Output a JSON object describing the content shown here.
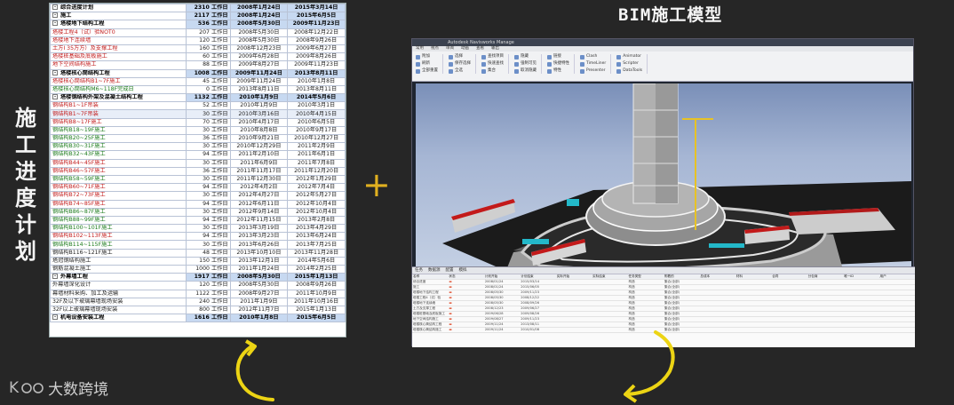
{
  "vertical_label": [
    "施",
    "工",
    "进",
    "度",
    "计",
    "划"
  ],
  "bim_title": "BIM施工模型",
  "plus_sign": "+",
  "schedule": {
    "rows": [
      {
        "level": 0,
        "toggle": "-",
        "name": "综合进度计划",
        "duration": "2310 工作日",
        "start": "2008年1月24日",
        "end": "2015年3月14日",
        "summary": true
      },
      {
        "level": 1,
        "toggle": "-",
        "name": "施工",
        "duration": "2117 工作日",
        "start": "2008年1月24日",
        "end": "2015年6月5日",
        "summary": true
      },
      {
        "level": 2,
        "toggle": "-",
        "name": "塔楼地下结构工程",
        "duration": "536 工作日",
        "start": "2008年5月30日",
        "end": "2009年11月23日",
        "summary": true
      },
      {
        "level": 3,
        "name": "塔楼工程4（试）验NOT0",
        "duration": "207 工作日",
        "start": "2008年5月30日",
        "end": "2008年12月22日",
        "color": "red"
      },
      {
        "level": 3,
        "name": "塔楼地下连续墙",
        "duration": "120 工作日",
        "start": "2008年5月30日",
        "end": "2008年9月26日",
        "color": "red"
      },
      {
        "level": 3,
        "name": "土方Ⅰ 35万方）及支撑工程",
        "duration": "160 工作日",
        "start": "2008年12月23日",
        "end": "2009年6月27日",
        "color": "red"
      },
      {
        "level": 3,
        "name": "塔楼桩基础及底板施工",
        "duration": "60 工作日",
        "start": "2009年6月28日",
        "end": "2009年8月26日",
        "color": "red"
      },
      {
        "level": 3,
        "name": "地下空间结构施工",
        "duration": "88 工作日",
        "start": "2009年8月27日",
        "end": "2009年11月23日",
        "color": "red"
      },
      {
        "level": 2,
        "toggle": "-",
        "name": "塔楼核心筒结构工程",
        "duration": "1008 工作日",
        "start": "2009年11月24日",
        "end": "2013年8月11日",
        "summary": true
      },
      {
        "level": 3,
        "name": "塔楼核心筒结构B1~7F施工",
        "duration": "45 工作日",
        "start": "2009年11月24日",
        "end": "2010年1月8日",
        "color": "red"
      },
      {
        "level": 3,
        "name": "塔楼核心筒结构M6~118F完成日",
        "duration": "0 工作日",
        "start": "2013年8月11日",
        "end": "2013年8月11日",
        "color": "green"
      },
      {
        "level": 2,
        "toggle": "-",
        "name": "塔楼钢结构外架及混凝土结构工程",
        "duration": "1132 工作日",
        "start": "2010年1月9日",
        "end": "2014年5月6日",
        "summary": true
      },
      {
        "level": 3,
        "name": "钢结构B1~1F吊装",
        "duration": "52 工作日",
        "start": "2010年1月9日",
        "end": "2010年3月1日",
        "color": "red"
      },
      {
        "level": 3,
        "name": "钢结构B1~7F吊装",
        "duration": "30 工作日",
        "start": "2010年3月16日",
        "end": "2010年4月15日",
        "color": "red",
        "selected": true
      },
      {
        "level": 3,
        "name": "钢结构B8~17F施工",
        "duration": "70 工作日",
        "start": "2010年4月17日",
        "end": "2010年6月5日",
        "color": "red"
      },
      {
        "level": 3,
        "name": "钢结构B18~19F施工",
        "duration": "30 工作日",
        "start": "2010年8月8日",
        "end": "2010年9月17日",
        "color": "green"
      },
      {
        "level": 3,
        "name": "钢结构B20~25F施工",
        "duration": "36 工作日",
        "start": "2010年9月21日",
        "end": "2010年12月27日",
        "color": "green"
      },
      {
        "level": 3,
        "name": "钢结构B30~31F施工",
        "duration": "30 工作日",
        "start": "2010年12月29日",
        "end": "2011年2月9日",
        "color": "green"
      },
      {
        "level": 3,
        "name": "钢结构B32~43F施工",
        "duration": "94 工作日",
        "start": "2011年2月10日",
        "end": "2011年6月1日",
        "color": "green"
      },
      {
        "level": 3,
        "name": "钢结构B44~45F施工",
        "duration": "30 工作日",
        "start": "2011年6月9日",
        "end": "2011年7月8日",
        "color": "red"
      },
      {
        "level": 3,
        "name": "钢结构B46~57F施工",
        "duration": "36 工作日",
        "start": "2011年11月17日",
        "end": "2011年12月20日",
        "color": "red"
      },
      {
        "level": 3,
        "name": "钢结构B58~59F施工",
        "duration": "30 工作日",
        "start": "2011年12月30日",
        "end": "2012年1月29日",
        "color": "green"
      },
      {
        "level": 3,
        "name": "钢结构B60~71F施工",
        "duration": "94 工作日",
        "start": "2012年4月2日",
        "end": "2012年7月4日",
        "color": "red"
      },
      {
        "level": 3,
        "name": "钢结构B72~73F施工",
        "duration": "30 工作日",
        "start": "2012年4月27日",
        "end": "2012年5月27日",
        "color": "red"
      },
      {
        "level": 3,
        "name": "钢结构B74~85F施工",
        "duration": "94 工作日",
        "start": "2012年6月11日",
        "end": "2012年10月4日",
        "color": "red"
      },
      {
        "level": 3,
        "name": "钢结构B86~87F施工",
        "duration": "30 工作日",
        "start": "2012年9月14日",
        "end": "2012年10月4日",
        "color": "green"
      },
      {
        "level": 3,
        "name": "钢结构B88~99F施工",
        "duration": "94 工作日",
        "start": "2012年11月15日",
        "end": "2013年2月8日",
        "color": "green"
      },
      {
        "level": 3,
        "name": "钢结构B100~101F施工",
        "duration": "30 工作日",
        "start": "2013年3月19日",
        "end": "2013年4月29日",
        "color": "green"
      },
      {
        "level": 3,
        "name": "钢结构B102~113F施工",
        "duration": "94 工作日",
        "start": "2013年3月23日",
        "end": "2013年6月24日",
        "color": "red"
      },
      {
        "level": 3,
        "name": "钢结构B114~115F施工",
        "duration": "30 工作日",
        "start": "2013年6月26日",
        "end": "2013年7月25日",
        "color": "green"
      },
      {
        "level": 3,
        "name": "钢结构B116~121F施工",
        "duration": "48 工作日",
        "start": "2013年10月10日",
        "end": "2013年11月28日",
        "color": "black"
      },
      {
        "level": 3,
        "name": "塔冠钢结构施工",
        "duration": "150 工作日",
        "start": "2013年12月1日",
        "end": "2014年5月6日",
        "color": "black"
      },
      {
        "level": 3,
        "name": "钢筋混凝土施工",
        "duration": "1000 工作日",
        "start": "2011年1月24日",
        "end": "2014年2月25日",
        "color": "black"
      },
      {
        "level": 2,
        "toggle": "-",
        "name": "外幕墙工程",
        "duration": "1917 工作日",
        "start": "2008年5月30日",
        "end": "2015年1月13日",
        "summary": true
      },
      {
        "level": 3,
        "name": "外幕墙深化设计",
        "duration": "120 工作日",
        "start": "2008年5月30日",
        "end": "2008年9月26日",
        "color": "black"
      },
      {
        "level": 3,
        "name": "幕墙材料采购、加工及运输",
        "duration": "1122 工作日",
        "start": "2008年9月27日",
        "end": "2011年10月9日",
        "color": "black"
      },
      {
        "level": 3,
        "name": "32F及以下玻璃幕墙现场安装",
        "duration": "240 工作日",
        "start": "2011年1月9日",
        "end": "2011年10月16日",
        "color": "black"
      },
      {
        "level": 3,
        "name": "32F以上玻璃幕墙现场安装",
        "duration": "800 工作日",
        "start": "2012年11月7日",
        "end": "2015年1月13日",
        "color": "black"
      },
      {
        "level": 2,
        "toggle": "-",
        "name": "机电设备安装工程",
        "duration": "1616 工作日",
        "start": "2010年1月8日",
        "end": "2015年6月5日",
        "summary": true
      }
    ]
  },
  "app": {
    "window_title": "Autodesk Navisworks Manage",
    "tabs": [
      "常用",
      "视点",
      "审阅",
      "动画",
      "查看",
      "输出"
    ],
    "ribbon_groups": [
      {
        "buttons": [
          "附加",
          "刷新",
          "全部重置"
        ]
      },
      {
        "buttons": [
          "选择",
          "保存选择",
          "全选"
        ]
      },
      {
        "buttons": [
          "查找项目",
          "快速查找",
          "集合"
        ]
      },
      {
        "buttons": [
          "隐藏",
          "强制可见",
          "取消隐藏"
        ]
      },
      {
        "buttons": [
          "链接",
          "快捷特性",
          "特性"
        ]
      },
      {
        "buttons": [
          "Clash",
          "TimeLiner",
          "Presenter"
        ]
      },
      {
        "buttons": [
          "Animator",
          "Scripter",
          "DataTools"
        ]
      }
    ],
    "panel_tabs": [
      "任务",
      "数据源",
      "配置",
      "模拟"
    ],
    "task_headers": [
      "名称",
      "状态",
      "计划开始",
      "计划结束",
      "实际开始",
      "实际结束",
      "任务类型",
      "附着的",
      "总成本",
      "材料",
      "合同",
      "分包商",
      "唯一ID",
      "用户"
    ],
    "task_rows": [
      {
        "name": "综合进度",
        "status": "▬",
        "start": "2008/01/24",
        "end": "2015/03/14",
        "type": "构造",
        "attached": "集合(全部)"
      },
      {
        "name": "施工",
        "status": "▬",
        "start": "2008/01/24",
        "end": "2015/06/05",
        "type": "构造",
        "attached": "集合(全部)"
      },
      {
        "name": "塔楼地下结构工程",
        "status": "▬",
        "start": "2008/05/30",
        "end": "2009/11/23",
        "type": "构造",
        "attached": "集合(全部)"
      },
      {
        "name": "塔楼工程4（试）验",
        "status": "▬",
        "start": "2008/05/30",
        "end": "2008/12/22",
        "type": "构造",
        "attached": "集合(全部)"
      },
      {
        "name": "塔楼地下连续墙",
        "status": "▬",
        "start": "2008/05/30",
        "end": "2008/09/26",
        "type": "构造",
        "attached": "集合(全部)"
      },
      {
        "name": "土方及支撑工程",
        "status": "▬",
        "start": "2008/12/23",
        "end": "2009/06/27",
        "type": "构造",
        "attached": "集合(全部)"
      },
      {
        "name": "塔楼桩基础及底板施工",
        "status": "▬",
        "start": "2009/06/28",
        "end": "2009/08/26",
        "type": "构造",
        "attached": "集合(全部)"
      },
      {
        "name": "地下空间结构施工",
        "status": "▬",
        "start": "2009/08/27",
        "end": "2009/11/23",
        "type": "构造",
        "attached": "集合(全部)"
      },
      {
        "name": "塔楼核心筒结构工程",
        "status": "▬",
        "start": "2009/11/24",
        "end": "2013/08/11",
        "type": "构造",
        "attached": "集合(全部)"
      },
      {
        "name": "塔楼核心筒结构施工",
        "status": "▬",
        "start": "2009/11/24",
        "end": "2010/01/08",
        "type": "构造",
        "attached": "集合(全部)"
      }
    ]
  },
  "watermark": {
    "logo": "K",
    "text": "大数跨境"
  }
}
